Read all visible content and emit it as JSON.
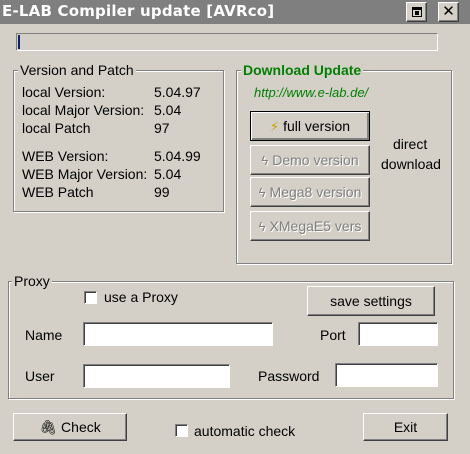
{
  "window": {
    "title": "E-LAB Compiler update [AVRco]",
    "restore_label": "",
    "close_label": "✕"
  },
  "progress": {
    "value": 0
  },
  "version_group": {
    "legend": "Version and Patch",
    "rows": [
      {
        "label": "local Version:",
        "value": "5.04.97"
      },
      {
        "label": "local Major Version:",
        "value": "5.04"
      },
      {
        "label": "local Patch",
        "value": "97"
      },
      {
        "label": "WEB Version:",
        "value": "5.04.99"
      },
      {
        "label": "WEB Major Version:",
        "value": "5.04"
      },
      {
        "label": "WEB Patch",
        "value": "99"
      }
    ]
  },
  "download_group": {
    "legend": "Download Update",
    "url": "http://www.e-lab.de/",
    "buttons": {
      "full": "full version",
      "demo": "Demo version",
      "mega8": "Mega8 version",
      "xmega": "XMegaE5 vers"
    },
    "direct_line1": "direct",
    "direct_line2": "download",
    "icon": "lightning-icon"
  },
  "proxy_group": {
    "legend": "Proxy",
    "use_proxy_label": "use a Proxy",
    "use_proxy_checked": false,
    "save_button": "save settings",
    "name_label": "Name",
    "port_label": "Port",
    "user_label": "User",
    "password_label": "Password",
    "name_value": "",
    "port_value": "",
    "user_value": "",
    "password_value": ""
  },
  "footer": {
    "check_button": "Check",
    "check_icon": "paperclip-icon",
    "auto_check_label": "automatic check",
    "auto_check_checked": false,
    "exit_button": "Exit"
  }
}
